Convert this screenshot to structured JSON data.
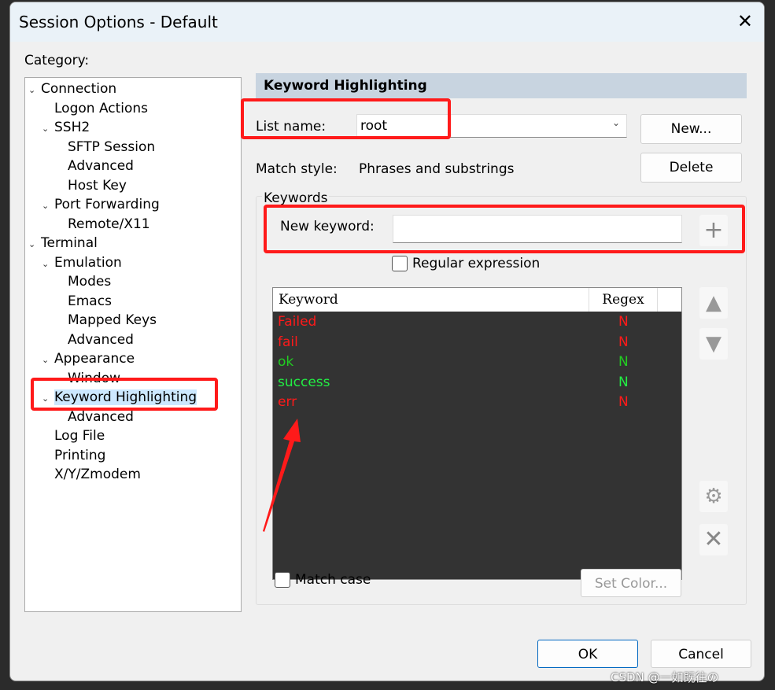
{
  "window": {
    "title": "Session Options - Default",
    "close_glyph": "✕"
  },
  "category_label": "Category:",
  "tree": [
    {
      "label": "Connection",
      "level": 0,
      "chev": true
    },
    {
      "label": "Logon Actions",
      "level": 1,
      "chev": false
    },
    {
      "label": "SSH2",
      "level": 1,
      "chev": true
    },
    {
      "label": "SFTP Session",
      "level": 2,
      "chev": false
    },
    {
      "label": "Advanced",
      "level": 2,
      "chev": false
    },
    {
      "label": "Host Key",
      "level": 2,
      "chev": false
    },
    {
      "label": "Port Forwarding",
      "level": 1,
      "chev": true
    },
    {
      "label": "Remote/X11",
      "level": 2,
      "chev": false
    },
    {
      "label": "Terminal",
      "level": 0,
      "chev": true
    },
    {
      "label": "Emulation",
      "level": 1,
      "chev": true
    },
    {
      "label": "Modes",
      "level": 2,
      "chev": false
    },
    {
      "label": "Emacs",
      "level": 2,
      "chev": false
    },
    {
      "label": "Mapped Keys",
      "level": 2,
      "chev": false
    },
    {
      "label": "Advanced",
      "level": 2,
      "chev": false
    },
    {
      "label": "Appearance",
      "level": 1,
      "chev": true
    },
    {
      "label": "Window",
      "level": 2,
      "chev": false
    },
    {
      "label": "Keyword Highlighting",
      "level": 1,
      "chev": true,
      "selected": true
    },
    {
      "label": "Advanced",
      "level": 2,
      "chev": false
    },
    {
      "label": "Log File",
      "level": 1,
      "chev": false
    },
    {
      "label": "Printing",
      "level": 1,
      "chev": false
    },
    {
      "label": "X/Y/Zmodem",
      "level": 1,
      "chev": false
    }
  ],
  "panel": {
    "header": "Keyword Highlighting",
    "list_name_label": "List name:",
    "list_name_value": "root",
    "new_button": "New...",
    "delete_button": "Delete",
    "match_style_label": "Match style:",
    "match_style_value": "Phrases and substrings",
    "keywords_group": "Keywords",
    "new_keyword_label": "New keyword:",
    "new_keyword_value": "",
    "regex_checkbox": "Regular expression",
    "columns": [
      "Keyword",
      "Regex"
    ],
    "keywords": [
      {
        "keyword": "Failed",
        "regex": "N",
        "color": "#ff1a1a"
      },
      {
        "keyword": "fail",
        "regex": "N",
        "color": "#ff1a1a"
      },
      {
        "keyword": "ok",
        "regex": "N",
        "color": "#22cc22"
      },
      {
        "keyword": "success",
        "regex": "N",
        "color": "#22ee44"
      },
      {
        "keyword": "err",
        "regex": "N",
        "color": "#ff1a1a"
      }
    ],
    "match_case": "Match case",
    "set_color": "Set Color..."
  },
  "footer": {
    "ok": "OK",
    "cancel": "Cancel"
  },
  "watermark": "CSDN @一如既往の",
  "annotation_color": "#ff1a1a"
}
